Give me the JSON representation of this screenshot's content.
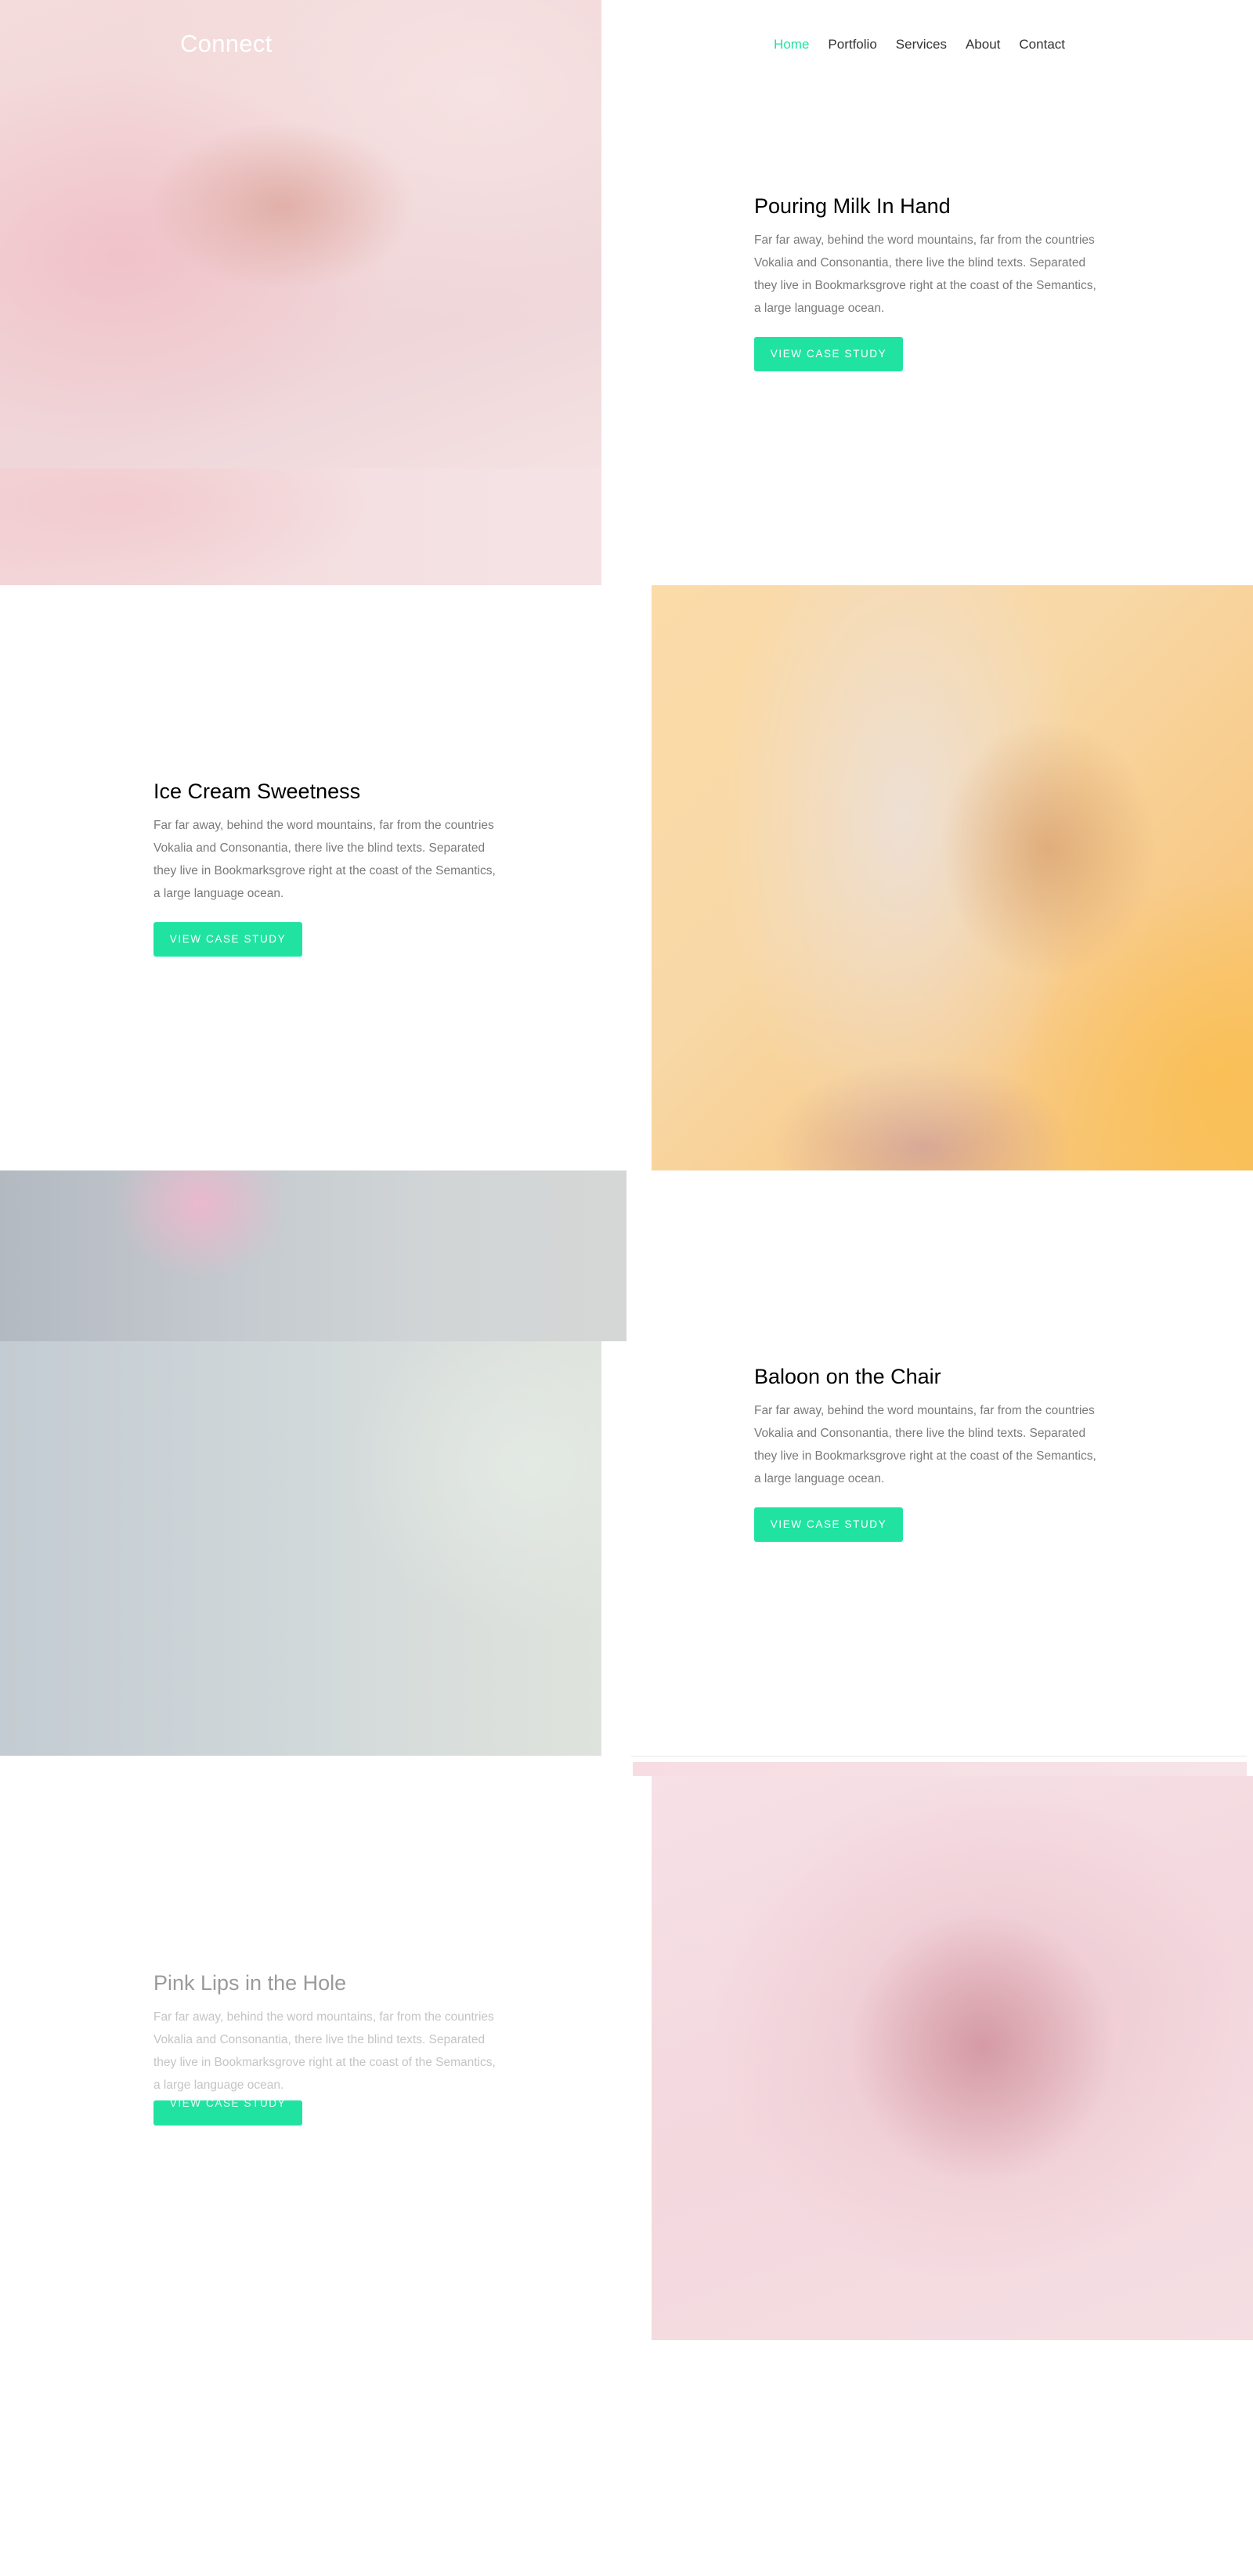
{
  "header": {
    "brand": "Connect",
    "nav": [
      {
        "label": "Home",
        "active": true
      },
      {
        "label": "Portfolio",
        "active": false
      },
      {
        "label": "Services",
        "active": false
      },
      {
        "label": "About",
        "active": false
      },
      {
        "label": "Contact",
        "active": false
      }
    ]
  },
  "colors": {
    "accent": "#20e3a2",
    "heading": "#000000",
    "body_text": "#7a7a7a"
  },
  "projects": [
    {
      "title": "Pouring Milk In Hand",
      "description": "Far far away, behind the word mountains, far from the countries Vokalia and Consonantia, there live the blind texts. Separated they live in Bookmarksgrove right at the coast of the Semantics, a large language ocean.",
      "button": "VIEW CASE STUDY",
      "image": "milk-photo"
    },
    {
      "title": "Ice Cream Sweetness",
      "description": "Far far away, behind the word mountains, far from the countries Vokalia and Consonantia, there live the blind texts. Separated they live in Bookmarksgrove right at the coast of the Semantics, a large language ocean.",
      "button": "VIEW CASE STUDY",
      "image": "ice-cream-photo"
    },
    {
      "title": "Baloon on the Chair",
      "description": "Far far away, behind the word mountains, far from the countries Vokalia and Consonantia, there live the blind texts. Separated they live in Bookmarksgrove right at the coast of the Semantics, a large language ocean.",
      "button": "VIEW CASE STUDY",
      "image": "baloon-photo"
    },
    {
      "title": "Pink Lips in the Hole",
      "description": "Far far away, behind the word mountains, far from the countries Vokalia and Consonantia, there live the blind texts. Separated they live in Bookmarksgrove right at the coast of the Semantics, a large language ocean.",
      "button": "VIEW CASE STUDY",
      "image": "lips-photo"
    }
  ]
}
